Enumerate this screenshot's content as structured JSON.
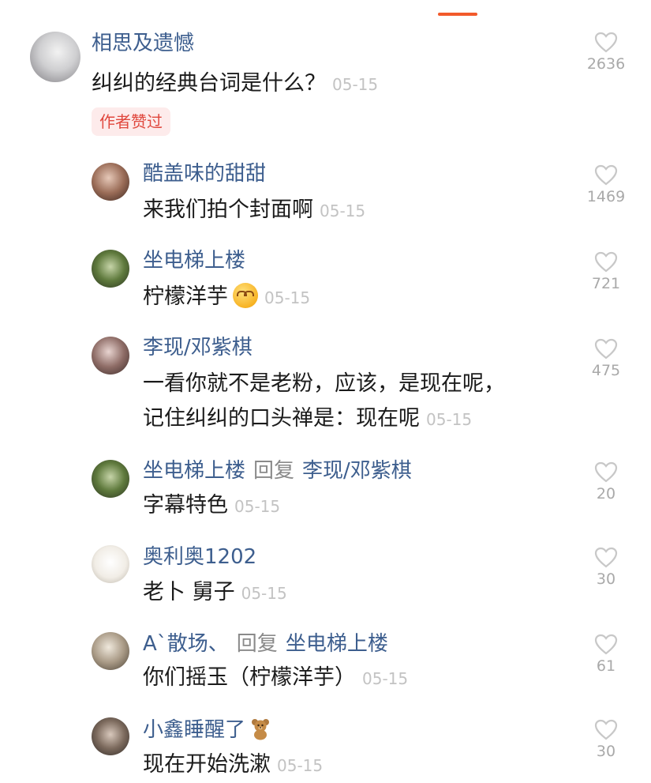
{
  "comments": [
    {
      "name": "相思及遗憾",
      "text": "纠纠的经典台词是什么？",
      "date": "05-15",
      "badge": "作者赞过",
      "likes": "2636"
    },
    {
      "name": "酷盖味的甜甜",
      "text": "来我们拍个封面啊",
      "date": "05-15",
      "likes": "1469"
    },
    {
      "name": "坐电梯上楼",
      "text": "柠檬洋芋",
      "emoji": "smiling-face-emoji",
      "date": "05-15",
      "likes": "721"
    },
    {
      "name": "李现/邓紫棋",
      "text_line1": "一看你就不是老粉，应该，是现在呢，",
      "text_line2": "记住纠纠的口头禅是：现在呢",
      "date": "05-15",
      "likes": "475"
    },
    {
      "name": "坐电梯上楼",
      "reply_word": "回复",
      "reply_to": "李现/邓紫棋",
      "text": "字幕特色",
      "date": "05-15",
      "likes": "20"
    },
    {
      "name": "奥利奥1202",
      "text": "老卜 舅子",
      "date": "05-15",
      "likes": "30"
    },
    {
      "name": "A`散场、",
      "reply_word": "回复",
      "reply_to": "坐电梯上楼",
      "text": "你们摇玉（柠檬洋芋）",
      "date": "05-15",
      "likes": "61"
    },
    {
      "name": "小鑫睡醒了",
      "name_icon": "teddy-bear-icon",
      "text": "现在开始洗漱",
      "date": "05-15",
      "likes": "30"
    }
  ],
  "colors": {
    "username": "#3d5e8e",
    "accent": "#f25a2b",
    "badge_text": "#e0483e",
    "badge_bg": "#fdebeb"
  }
}
